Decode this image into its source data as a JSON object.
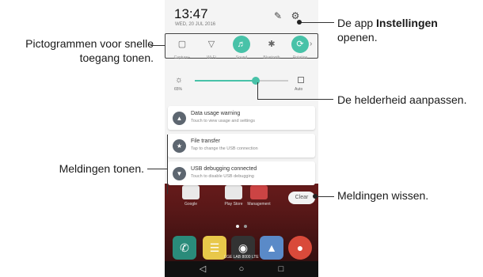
{
  "callouts": {
    "quick_settings": "Pictogrammen voor snelle toegang tonen.",
    "settings_pre": "De app ",
    "settings_bold": "Instellingen",
    "settings_post": "openen.",
    "brightness": "De helderheid aanpassen.",
    "notifications": "Meldingen tonen.",
    "clear": "Meldingen wissen."
  },
  "status": {
    "time": "13:47",
    "date": "WED, 20 JUL 2016"
  },
  "quick_settings": [
    {
      "label": "Capture+",
      "icon": "capture-icon",
      "on": false
    },
    {
      "label": "Wi-Fi",
      "icon": "wifi-icon",
      "on": false
    },
    {
      "label": "Sound",
      "icon": "sound-icon",
      "on": true
    },
    {
      "label": "Bluetooth",
      "icon": "bluetooth-icon",
      "on": false
    },
    {
      "label": "Rotation",
      "icon": "rotation-icon",
      "on": true
    }
  ],
  "brightness": {
    "percent_label": "65%",
    "auto_label": "Auto",
    "level": 0.65
  },
  "notifications": [
    {
      "title": "Data usage warning",
      "subtitle": "Touch to view usage and settings",
      "icon": "warning-icon"
    },
    {
      "title": "File transfer",
      "subtitle": "Tap to change the USB connection",
      "icon": "usb-icon"
    },
    {
      "title": "USB debugging connected",
      "subtitle": "Touch to disable USB debugging",
      "icon": "debug-icon"
    }
  ],
  "clear_label": "Clear",
  "home_apps": [
    {
      "label": "Google"
    },
    {
      "label": "Play Store"
    },
    {
      "label": "Management"
    }
  ],
  "carrier": "LGE LAB 8000 LTE",
  "colors": {
    "accent": "#48c2a8",
    "wallpaper": "#8b2323"
  }
}
